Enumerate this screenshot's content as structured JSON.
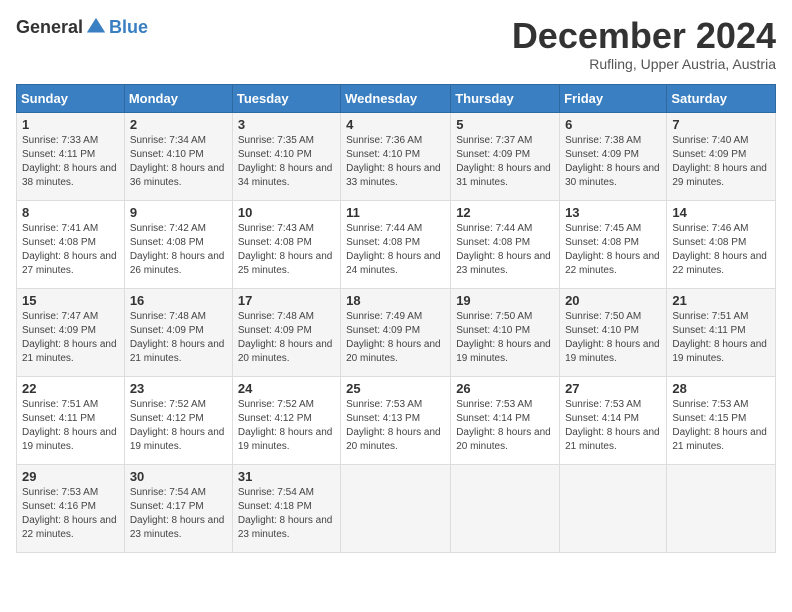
{
  "header": {
    "logo_general": "General",
    "logo_blue": "Blue",
    "title": "December 2024",
    "location": "Rufling, Upper Austria, Austria"
  },
  "calendar": {
    "days_of_week": [
      "Sunday",
      "Monday",
      "Tuesday",
      "Wednesday",
      "Thursday",
      "Friday",
      "Saturday"
    ],
    "weeks": [
      [
        null,
        {
          "day": "2",
          "sunrise": "Sunrise: 7:34 AM",
          "sunset": "Sunset: 4:10 PM",
          "daylight": "Daylight: 8 hours and 36 minutes."
        },
        {
          "day": "3",
          "sunrise": "Sunrise: 7:35 AM",
          "sunset": "Sunset: 4:10 PM",
          "daylight": "Daylight: 8 hours and 34 minutes."
        },
        {
          "day": "4",
          "sunrise": "Sunrise: 7:36 AM",
          "sunset": "Sunset: 4:10 PM",
          "daylight": "Daylight: 8 hours and 33 minutes."
        },
        {
          "day": "5",
          "sunrise": "Sunrise: 7:37 AM",
          "sunset": "Sunset: 4:09 PM",
          "daylight": "Daylight: 8 hours and 31 minutes."
        },
        {
          "day": "6",
          "sunrise": "Sunrise: 7:38 AM",
          "sunset": "Sunset: 4:09 PM",
          "daylight": "Daylight: 8 hours and 30 minutes."
        },
        {
          "day": "7",
          "sunrise": "Sunrise: 7:40 AM",
          "sunset": "Sunset: 4:09 PM",
          "daylight": "Daylight: 8 hours and 29 minutes."
        }
      ],
      [
        {
          "day": "1",
          "sunrise": "Sunrise: 7:33 AM",
          "sunset": "Sunset: 4:11 PM",
          "daylight": "Daylight: 8 hours and 38 minutes."
        },
        {
          "day": "9",
          "sunrise": "Sunrise: 7:42 AM",
          "sunset": "Sunset: 4:08 PM",
          "daylight": "Daylight: 8 hours and 26 minutes."
        },
        {
          "day": "10",
          "sunrise": "Sunrise: 7:43 AM",
          "sunset": "Sunset: 4:08 PM",
          "daylight": "Daylight: 8 hours and 25 minutes."
        },
        {
          "day": "11",
          "sunrise": "Sunrise: 7:44 AM",
          "sunset": "Sunset: 4:08 PM",
          "daylight": "Daylight: 8 hours and 24 minutes."
        },
        {
          "day": "12",
          "sunrise": "Sunrise: 7:44 AM",
          "sunset": "Sunset: 4:08 PM",
          "daylight": "Daylight: 8 hours and 23 minutes."
        },
        {
          "day": "13",
          "sunrise": "Sunrise: 7:45 AM",
          "sunset": "Sunset: 4:08 PM",
          "daylight": "Daylight: 8 hours and 22 minutes."
        },
        {
          "day": "14",
          "sunrise": "Sunrise: 7:46 AM",
          "sunset": "Sunset: 4:08 PM",
          "daylight": "Daylight: 8 hours and 22 minutes."
        }
      ],
      [
        {
          "day": "8",
          "sunrise": "Sunrise: 7:41 AM",
          "sunset": "Sunset: 4:08 PM",
          "daylight": "Daylight: 8 hours and 27 minutes."
        },
        {
          "day": "16",
          "sunrise": "Sunrise: 7:48 AM",
          "sunset": "Sunset: 4:09 PM",
          "daylight": "Daylight: 8 hours and 21 minutes."
        },
        {
          "day": "17",
          "sunrise": "Sunrise: 7:48 AM",
          "sunset": "Sunset: 4:09 PM",
          "daylight": "Daylight: 8 hours and 20 minutes."
        },
        {
          "day": "18",
          "sunrise": "Sunrise: 7:49 AM",
          "sunset": "Sunset: 4:09 PM",
          "daylight": "Daylight: 8 hours and 20 minutes."
        },
        {
          "day": "19",
          "sunrise": "Sunrise: 7:50 AM",
          "sunset": "Sunset: 4:10 PM",
          "daylight": "Daylight: 8 hours and 19 minutes."
        },
        {
          "day": "20",
          "sunrise": "Sunrise: 7:50 AM",
          "sunset": "Sunset: 4:10 PM",
          "daylight": "Daylight: 8 hours and 19 minutes."
        },
        {
          "day": "21",
          "sunrise": "Sunrise: 7:51 AM",
          "sunset": "Sunset: 4:11 PM",
          "daylight": "Daylight: 8 hours and 19 minutes."
        }
      ],
      [
        {
          "day": "15",
          "sunrise": "Sunrise: 7:47 AM",
          "sunset": "Sunset: 4:09 PM",
          "daylight": "Daylight: 8 hours and 21 minutes."
        },
        {
          "day": "23",
          "sunrise": "Sunrise: 7:52 AM",
          "sunset": "Sunset: 4:12 PM",
          "daylight": "Daylight: 8 hours and 19 minutes."
        },
        {
          "day": "24",
          "sunrise": "Sunrise: 7:52 AM",
          "sunset": "Sunset: 4:12 PM",
          "daylight": "Daylight: 8 hours and 19 minutes."
        },
        {
          "day": "25",
          "sunrise": "Sunrise: 7:53 AM",
          "sunset": "Sunset: 4:13 PM",
          "daylight": "Daylight: 8 hours and 20 minutes."
        },
        {
          "day": "26",
          "sunrise": "Sunrise: 7:53 AM",
          "sunset": "Sunset: 4:14 PM",
          "daylight": "Daylight: 8 hours and 20 minutes."
        },
        {
          "day": "27",
          "sunrise": "Sunrise: 7:53 AM",
          "sunset": "Sunset: 4:14 PM",
          "daylight": "Daylight: 8 hours and 21 minutes."
        },
        {
          "day": "28",
          "sunrise": "Sunrise: 7:53 AM",
          "sunset": "Sunset: 4:15 PM",
          "daylight": "Daylight: 8 hours and 21 minutes."
        }
      ],
      [
        {
          "day": "22",
          "sunrise": "Sunrise: 7:51 AM",
          "sunset": "Sunset: 4:11 PM",
          "daylight": "Daylight: 8 hours and 19 minutes."
        },
        {
          "day": "30",
          "sunrise": "Sunrise: 7:54 AM",
          "sunset": "Sunset: 4:17 PM",
          "daylight": "Daylight: 8 hours and 23 minutes."
        },
        {
          "day": "31",
          "sunrise": "Sunrise: 7:54 AM",
          "sunset": "Sunset: 4:18 PM",
          "daylight": "Daylight: 8 hours and 23 minutes."
        },
        null,
        null,
        null,
        null
      ],
      [
        {
          "day": "29",
          "sunrise": "Sunrise: 7:53 AM",
          "sunset": "Sunset: 4:16 PM",
          "daylight": "Daylight: 8 hours and 22 minutes."
        },
        null,
        null,
        null,
        null,
        null,
        null
      ]
    ]
  }
}
